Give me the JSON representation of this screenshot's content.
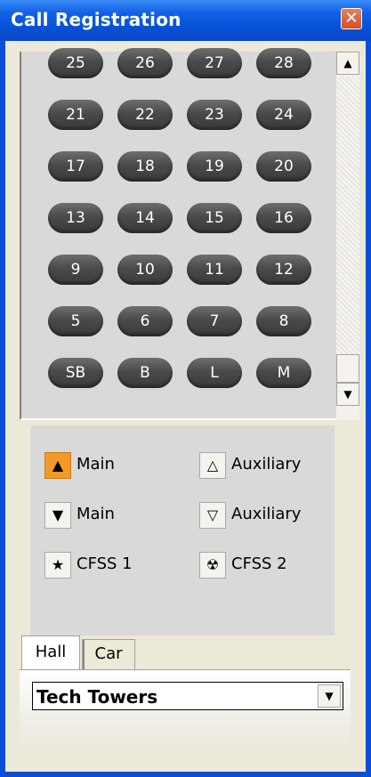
{
  "window": {
    "title": "Call Registration",
    "close_glyph": "✕"
  },
  "floors": {
    "rows": [
      [
        "25",
        "26",
        "27",
        "28"
      ],
      [
        "21",
        "22",
        "23",
        "24"
      ],
      [
        "17",
        "18",
        "19",
        "20"
      ],
      [
        "13",
        "14",
        "15",
        "16"
      ],
      [
        "9",
        "10",
        "11",
        "12"
      ],
      [
        "5",
        "6",
        "7",
        "8"
      ],
      [
        "SB",
        "B",
        "L",
        "M"
      ]
    ]
  },
  "scrollbar": {
    "up_glyph": "▲",
    "down_glyph": "▼"
  },
  "calls": [
    {
      "icon": "up-arrow-icon",
      "glyph": "▲",
      "label": "Main",
      "active": true
    },
    {
      "icon": "hollow-up-arrow-icon",
      "glyph": "△",
      "label": "Auxiliary",
      "active": false
    },
    {
      "icon": "down-arrow-icon",
      "glyph": "▼",
      "label": "Main",
      "active": false
    },
    {
      "icon": "hollow-down-arrow-icon",
      "glyph": "▽",
      "label": "Auxiliary",
      "active": false
    },
    {
      "icon": "star-icon",
      "glyph": "★",
      "label": "CFSS 1",
      "active": false
    },
    {
      "icon": "radiation-icon",
      "glyph": "☢",
      "label": "CFSS 2",
      "active": false
    }
  ],
  "tabs": [
    {
      "label": "Hall",
      "selected": true
    },
    {
      "label": "Car",
      "selected": false
    }
  ],
  "building_select": {
    "value": "Tech Towers",
    "arrow_glyph": "▼"
  },
  "colors": {
    "active_call": "#f39a26",
    "floor_button": "#4a4a4a"
  }
}
